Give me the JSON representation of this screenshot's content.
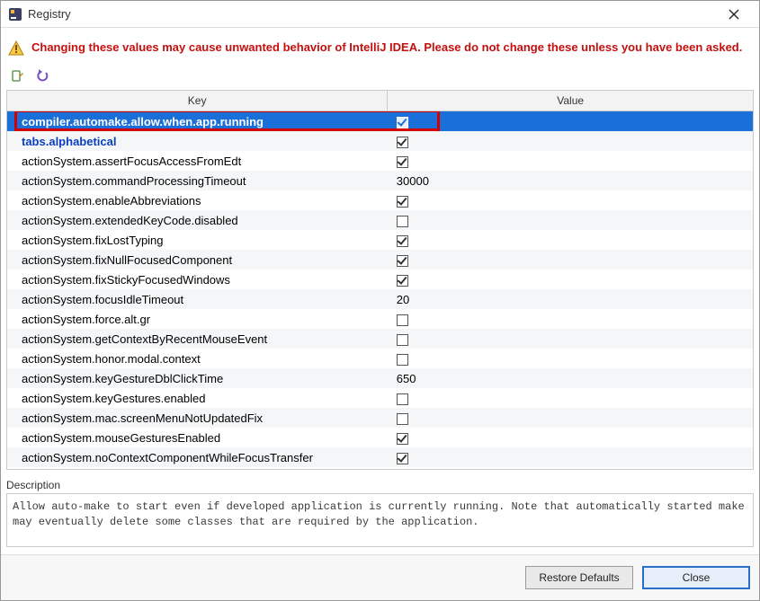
{
  "window": {
    "title": "Registry"
  },
  "warning": "Changing these values may cause unwanted behavior of IntelliJ IDEA. Please do not change these unless you have been asked.",
  "columns": {
    "key": "Key",
    "value": "Value"
  },
  "rows": [
    {
      "key": "compiler.automake.allow.when.app.running",
      "type": "checkbox",
      "value": true,
      "selected": true,
      "highlighted": true
    },
    {
      "key": "tabs.alphabetical",
      "type": "checkbox",
      "value": true,
      "modified": true
    },
    {
      "key": "actionSystem.assertFocusAccessFromEdt",
      "type": "checkbox",
      "value": true
    },
    {
      "key": "actionSystem.commandProcessingTimeout",
      "type": "text",
      "value": "30000"
    },
    {
      "key": "actionSystem.enableAbbreviations",
      "type": "checkbox",
      "value": true
    },
    {
      "key": "actionSystem.extendedKeyCode.disabled",
      "type": "checkbox",
      "value": false
    },
    {
      "key": "actionSystem.fixLostTyping",
      "type": "checkbox",
      "value": true
    },
    {
      "key": "actionSystem.fixNullFocusedComponent",
      "type": "checkbox",
      "value": true
    },
    {
      "key": "actionSystem.fixStickyFocusedWindows",
      "type": "checkbox",
      "value": true
    },
    {
      "key": "actionSystem.focusIdleTimeout",
      "type": "text",
      "value": "20"
    },
    {
      "key": "actionSystem.force.alt.gr",
      "type": "checkbox",
      "value": false
    },
    {
      "key": "actionSystem.getContextByRecentMouseEvent",
      "type": "checkbox",
      "value": false
    },
    {
      "key": "actionSystem.honor.modal.context",
      "type": "checkbox",
      "value": false
    },
    {
      "key": "actionSystem.keyGestureDblClickTime",
      "type": "text",
      "value": "650"
    },
    {
      "key": "actionSystem.keyGestures.enabled",
      "type": "checkbox",
      "value": false
    },
    {
      "key": "actionSystem.mac.screenMenuNotUpdatedFix",
      "type": "checkbox",
      "value": false
    },
    {
      "key": "actionSystem.mouseGesturesEnabled",
      "type": "checkbox",
      "value": true
    },
    {
      "key": "actionSystem.noContextComponentWhileFocusTransfer",
      "type": "checkbox",
      "value": true
    }
  ],
  "description_label": "Description",
  "description": "Allow auto-make to start even if developed application is currently running. Note that automatically started make may eventually delete some classes that are required by the application.",
  "buttons": {
    "restore": "Restore Defaults",
    "close": "Close"
  }
}
